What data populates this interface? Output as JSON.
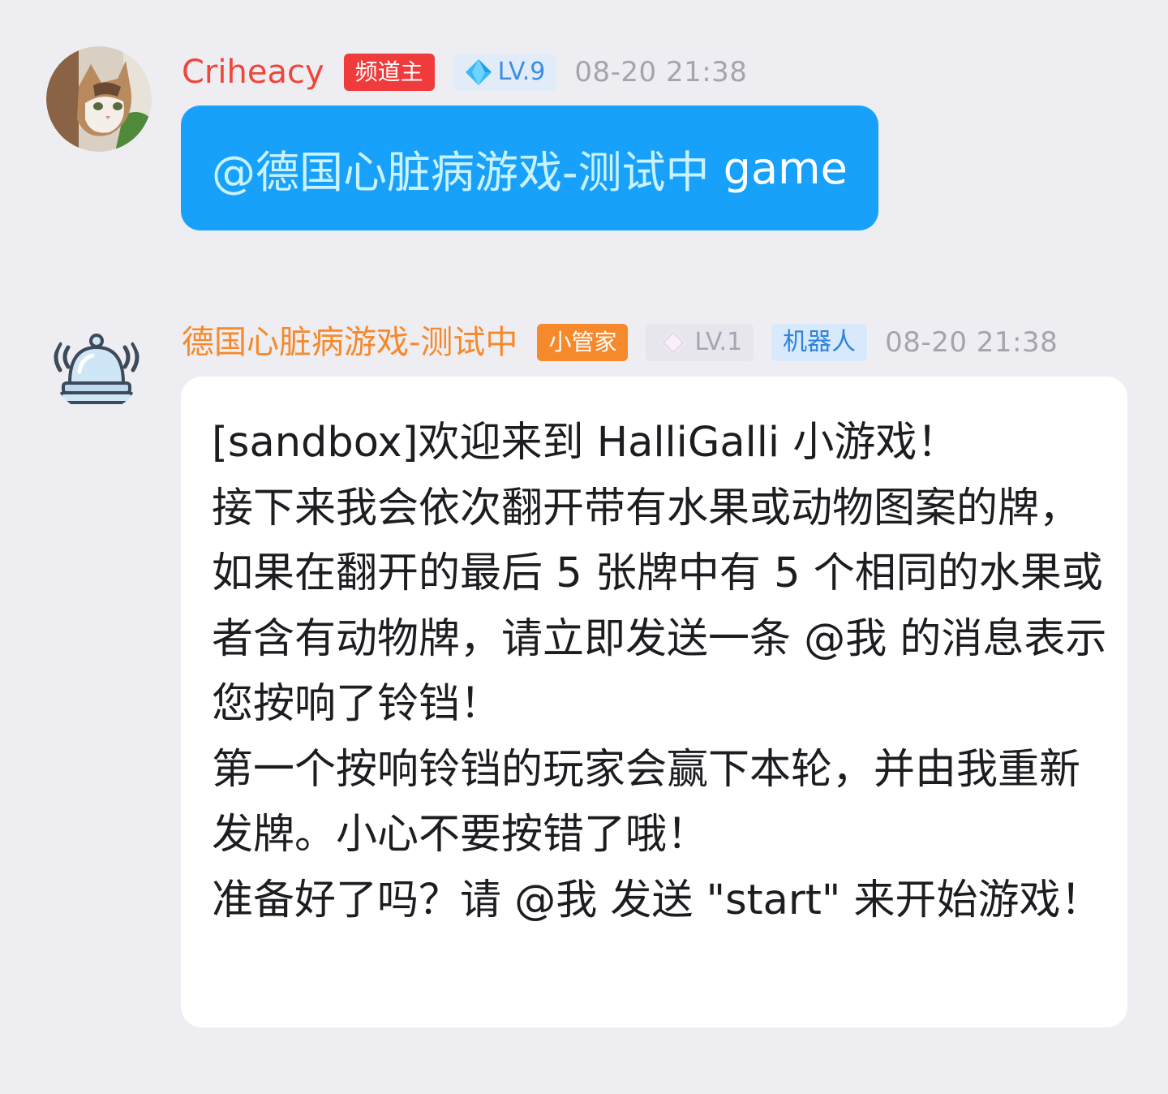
{
  "messages": [
    {
      "username": "Criheacy",
      "username_color": "#f0453b",
      "role_badge": "频道主",
      "level_badge": "LV.9",
      "time": "08-20 21:38",
      "avatar_icon": "cat-avatar",
      "content": {
        "mention": "@德国心脏病游戏-测试中",
        "text": "game"
      },
      "bubble_color": "#18a1fb"
    },
    {
      "username": "德国心脏病游戏-测试中",
      "username_color": "#f6892b",
      "role_badge": "小管家",
      "level_badge": "LV.1",
      "bot_badge": "机器人",
      "time": "08-20 21:38",
      "avatar_icon": "service-bell-icon",
      "lines": [
        "[sandbox]欢迎来到 HalliGalli 小游戏！",
        "接下来我会依次翻开带有水果或动物图案的牌，如果在翻开的最后 5 张牌中有 5 个相同的水果或者含有动物牌，请立即发送一条 @我 的消息表示您按响了铃铛！",
        "第一个按响铃铛的玩家会赢下本轮，并由我重新发牌。小心不要按错了哦！",
        "准备好了吗？请 @我 发送 \"start\" 来开始游戏！"
      ],
      "bubble_color": "#ffffff"
    }
  ]
}
